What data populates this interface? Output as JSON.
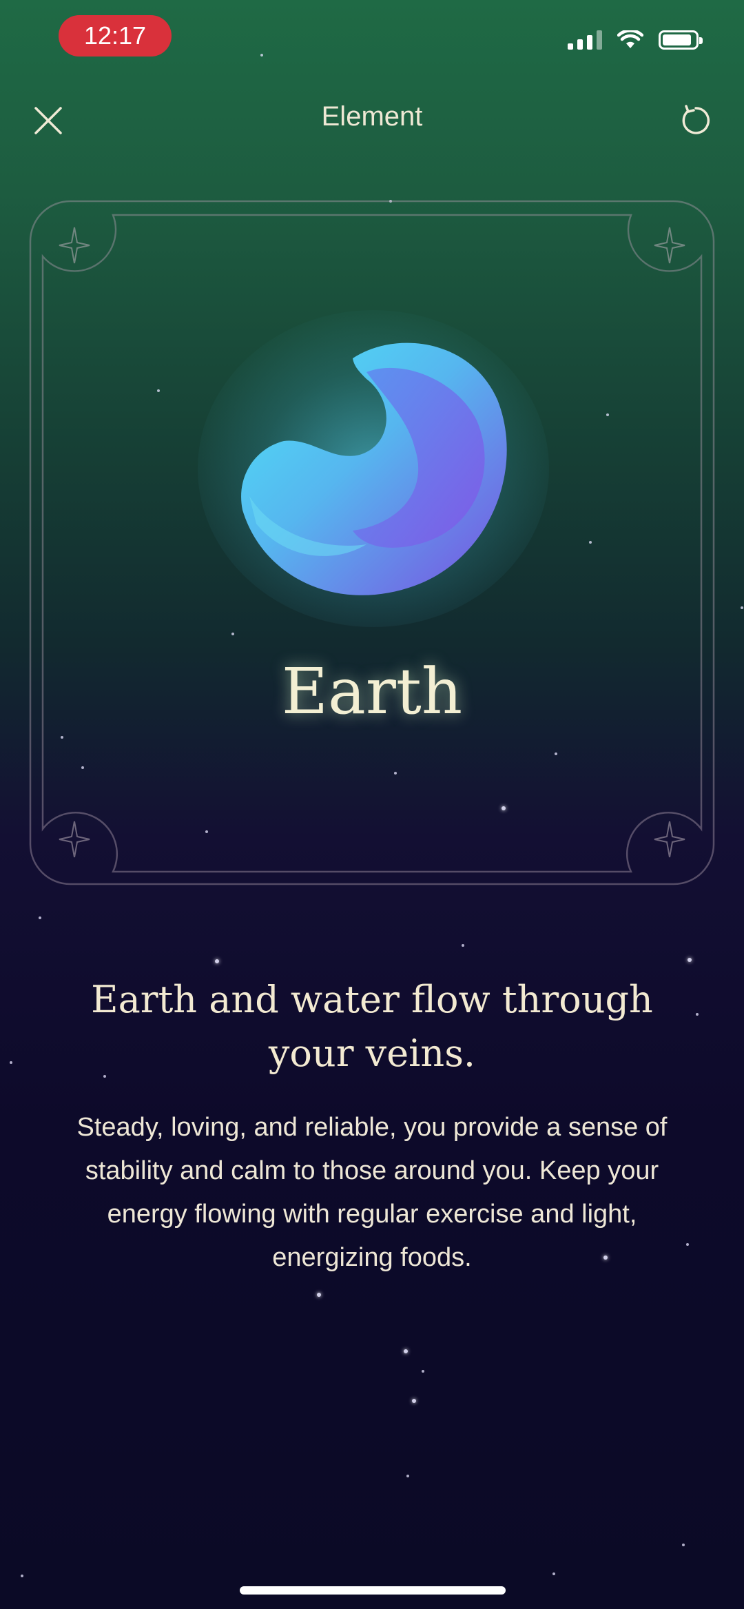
{
  "status_bar": {
    "time": "12:17"
  },
  "header": {
    "title": "Element"
  },
  "card": {
    "element_name": "Earth"
  },
  "content": {
    "headline": "Earth and water flow through your veins.",
    "body": "Steady, loving, and reliable, you provide a sense of stability and calm to those around you.  Keep your energy flowing with regular exercise and light, energizing foods."
  },
  "icons": [
    "close-icon",
    "refresh-icon",
    "signal-icon",
    "wifi-icon",
    "battery-icon",
    "sparkle-icon"
  ],
  "colors": {
    "accent_red": "#d9313b",
    "bg_top": "#1f6a45",
    "bg_bottom": "#0b0a26",
    "orb_cyan": "#49d6f2",
    "orb_violet": "#7a4fe0"
  }
}
